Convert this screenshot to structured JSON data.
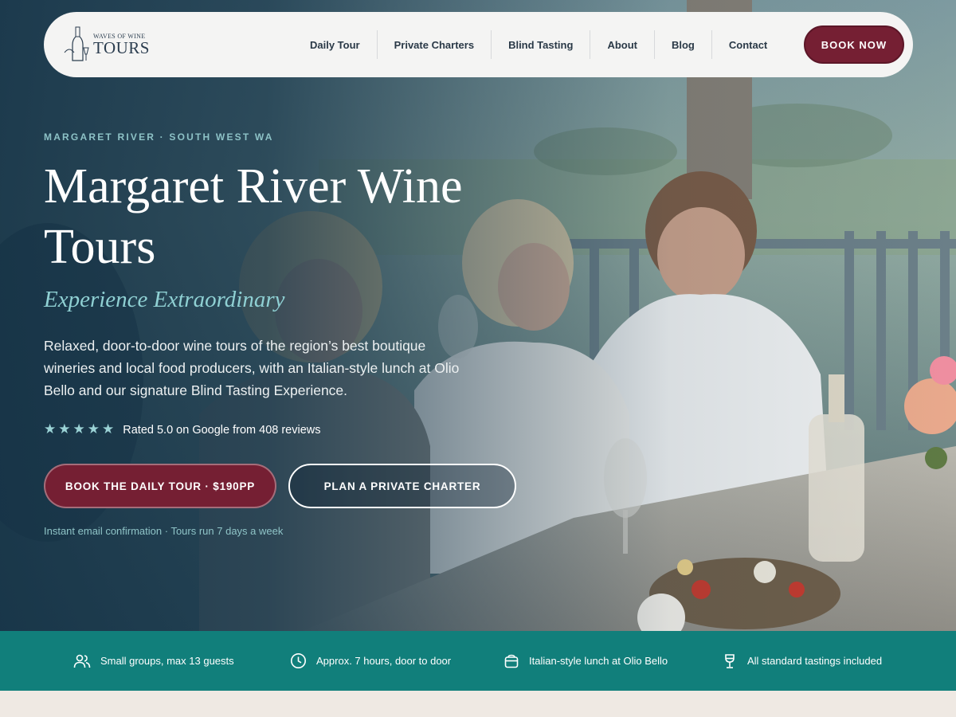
{
  "nav": {
    "logo": {
      "small_text": "WAVES OF WINE",
      "big_text": "TOURS"
    },
    "links": [
      "Daily Tour",
      "Private Charters",
      "Blind Tasting",
      "About",
      "Blog",
      "Contact"
    ],
    "cta": "BOOK NOW"
  },
  "hero": {
    "eyebrow": "MARGARET RIVER · SOUTH WEST WA",
    "title_line1": "Margaret River Wine",
    "title_line2": "Tours",
    "subtitle": "Experience Extraordinary",
    "description": "Relaxed, door-to-door wine tours of the region’s best boutique wineries and local food producers, with an Italian-style lunch at Olio Bello and our signature Blind Tasting Experience.",
    "rating_stars": 5,
    "rating_text": "Rated 5.0 on Google from 408 reviews",
    "primary_cta": "BOOK THE DAILY TOUR · $190PP",
    "secondary_cta": "PLAN A PRIVATE CHARTER",
    "note": "Instant email confirmation · Tours run 7 days a week"
  },
  "features": [
    {
      "icon": "users-icon",
      "text": "Small groups, max 13 guests"
    },
    {
      "icon": "clock-icon",
      "text": "Approx. 7 hours, door to door"
    },
    {
      "icon": "lunchbox-icon",
      "text": "Italian-style lunch at Olio Bello"
    },
    {
      "icon": "wine-glass-icon",
      "text": "All standard tastings included"
    }
  ],
  "colors": {
    "brand_burgundy": "#751f33",
    "teal_bar": "#117f7b",
    "accent_teal": "#8fd0d3",
    "navy_text": "#2a3947"
  }
}
